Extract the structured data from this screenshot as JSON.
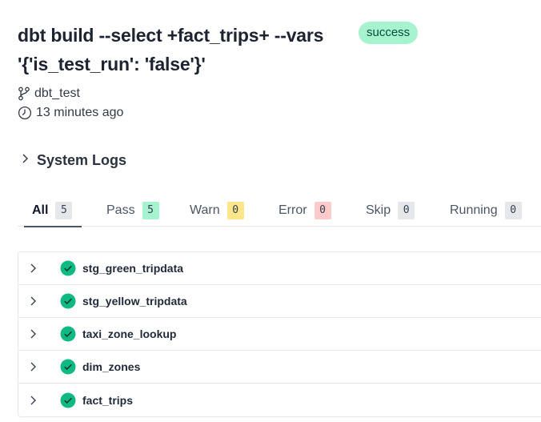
{
  "run": {
    "title": "dbt build --select +fact_trips+ --vars '{'is_test_run': 'false'}'",
    "status": "success",
    "project": "dbt_test",
    "started": "13 minutes ago"
  },
  "system_logs": {
    "label": "System Logs",
    "icon": "chevron-right-icon"
  },
  "tabs": [
    {
      "label": "All",
      "count": "5",
      "active": true
    },
    {
      "label": "Pass",
      "count": "5"
    },
    {
      "label": "Warn",
      "count": "0"
    },
    {
      "label": "Error",
      "count": "0"
    },
    {
      "label": "Skip",
      "count": "0"
    },
    {
      "label": "Running",
      "count": "0"
    }
  ],
  "models": [
    {
      "name": "stg_green_tripdata",
      "status_icon": "check-circle-icon"
    },
    {
      "name": "stg_yellow_tripdata",
      "status_icon": "check-circle-icon"
    },
    {
      "name": "taxi_zone_lookup",
      "status_icon": "check-circle-icon"
    },
    {
      "name": "dim_zones",
      "status_icon": "check-circle-icon"
    },
    {
      "name": "fact_trips",
      "status_icon": "check-circle-icon"
    }
  ],
  "colors": {
    "success_badge": "#a7f3d0",
    "success_icon": "#10b981",
    "warn_badge": "#fde68a",
    "error_badge": "#fecaca"
  }
}
